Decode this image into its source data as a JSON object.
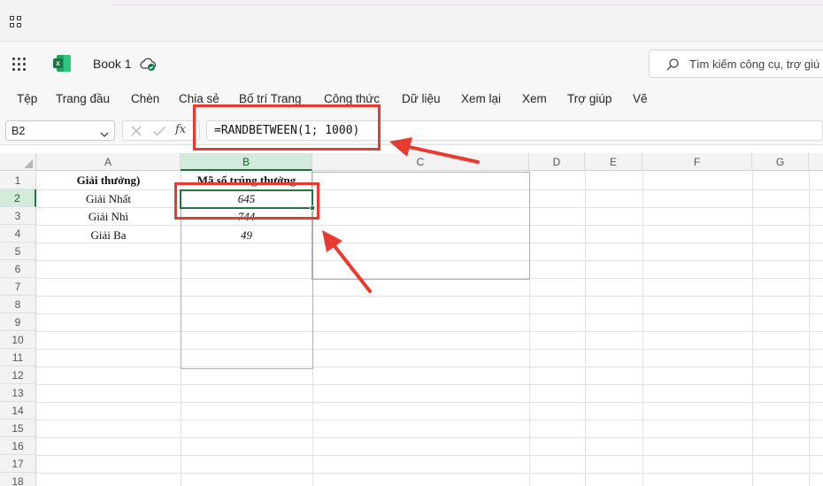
{
  "app": {
    "book_title": "Book 1"
  },
  "search": {
    "placeholder": "Tìm kiếm công cụ, trợ giú"
  },
  "menu": [
    "Tệp",
    "Trang đầu",
    "Chèn",
    "Chia sẻ",
    "Bố trí Trang",
    "Công thức",
    "Dữ liệu",
    "Xem lại",
    "Xem",
    "Trợ giúp",
    "Vẽ"
  ],
  "name_box": {
    "value": "B2"
  },
  "formula_bar": {
    "fx_label": "fx",
    "formula": "=RANDBETWEEN(1; 1000)"
  },
  "sheet": {
    "columns": [
      "A",
      "B",
      "C",
      "D",
      "E",
      "F",
      "G"
    ],
    "rows": [
      "1",
      "2",
      "3",
      "4",
      "5",
      "6",
      "7",
      "8",
      "9",
      "10",
      "11",
      "12",
      "13",
      "14",
      "15",
      "16",
      "17",
      "18"
    ],
    "selected_cell": "B2",
    "cells": {
      "A1": "Giải thưởng)",
      "B1": "Mã số trúng thưởng",
      "A2": "Giải Nhất",
      "B2": "645",
      "A3": "Giải Nhì",
      "B3": "744",
      "A4": "Giải Ba",
      "B4": "49"
    }
  },
  "annotations": {
    "color": "#e83a2e"
  },
  "colors": {
    "excel_green": "#217346",
    "selection_header": "#d3ebdd"
  }
}
